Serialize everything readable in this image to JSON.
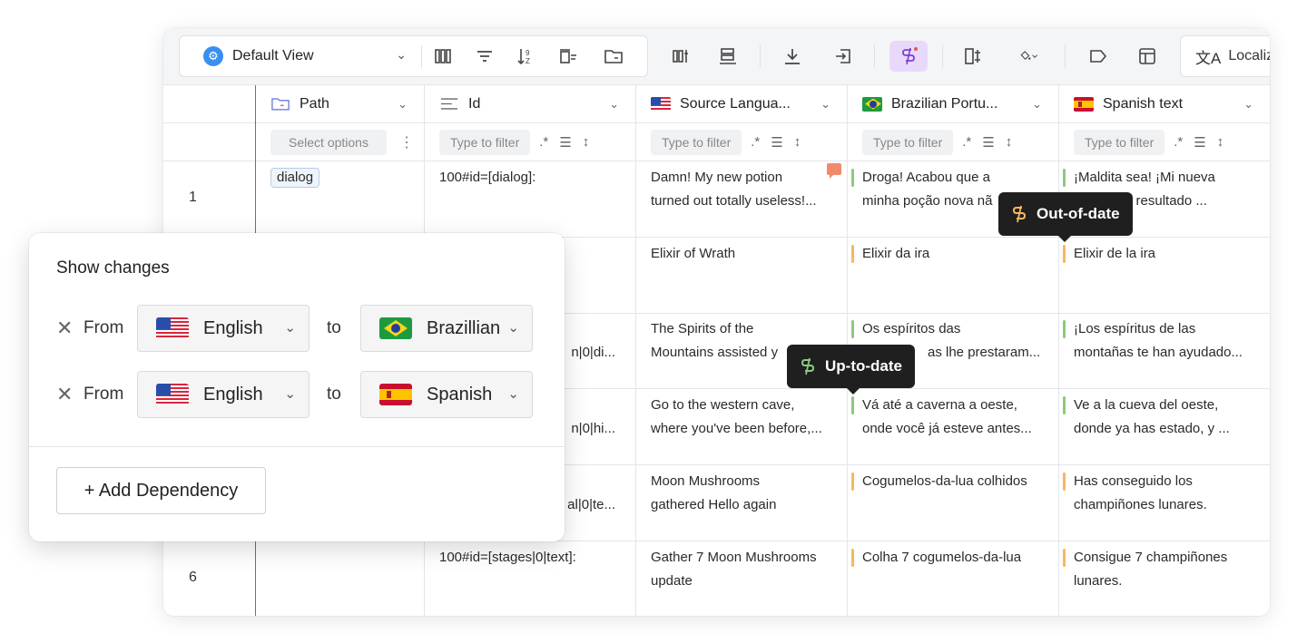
{
  "toolbar": {
    "view_label": "Default View",
    "localize_label": "Localiz"
  },
  "columns": [
    {
      "label": "Path",
      "icon": "folder-icon",
      "filter": "Select options"
    },
    {
      "label": "Id",
      "icon": "text-lines-icon",
      "filter": "Type to filter"
    },
    {
      "label": "Source Langua...",
      "icon": "flag-us",
      "filter": "Type to filter"
    },
    {
      "label": "Brazilian Portu...",
      "icon": "flag-br",
      "filter": "Type to filter"
    },
    {
      "label": "Spanish text",
      "icon": "flag-es",
      "filter": "Type to filter"
    }
  ],
  "rows": [
    {
      "num": "1",
      "path": "dialog",
      "id": "100#id=[dialog]:",
      "source": [
        "Damn! My new potion",
        "turned out totally useless!..."
      ],
      "br": [
        "Droga! Acabou que a",
        "minha poção nova nã"
      ],
      "es": [
        "¡Maldita sea! ¡Mi nueva",
        "a resultado ..."
      ]
    },
    {
      "num": "",
      "path": "",
      "id": "",
      "source": [
        "Elixir of Wrath"
      ],
      "br": [
        "Elixir da ira"
      ],
      "es": [
        "Elixir de la ira"
      ]
    },
    {
      "num": "",
      "path": "",
      "id": "n|0|di...",
      "source": [
        "The Spirits of the",
        "Mountains assisted y"
      ],
      "br": [
        "Os espíritos das",
        "as lhe prestaram..."
      ],
      "es": [
        "¡Los espíritus de las",
        "montañas te han ayudado..."
      ]
    },
    {
      "num": "",
      "path": "",
      "id": "n|0|hi...",
      "source": [
        "Go to the western cave,",
        "where you've been before,..."
      ],
      "br": [
        "Vá até a caverna a oeste,",
        "onde você já esteve antes..."
      ],
      "es": [
        "Ve a la cueva del oeste,",
        "donde ya has estado, y ..."
      ]
    },
    {
      "num": "",
      "path": "",
      "id": "al|0|te...",
      "source": [
        "Moon Mushrooms",
        "gathered Hello again"
      ],
      "br": [
        "Cogumelos-da-lua colhidos"
      ],
      "es": [
        "Has conseguido los",
        "champiñones lunares."
      ]
    },
    {
      "num": "6",
      "path": "",
      "id": "100#id=[stages|0|text]:",
      "source": [
        "Gather 7 Moon Mushrooms",
        "update"
      ],
      "br": [
        "Colha 7 cogumelos-da-lua"
      ],
      "es": [
        "Consigue 7 champiñones",
        "lunares."
      ]
    }
  ],
  "tooltips": {
    "out_of_date": "Out-of-date",
    "up_to_date": "Up-to-date"
  },
  "panel": {
    "title": "Show changes",
    "dependencies": [
      {
        "from_label": "From",
        "from_lang": "English",
        "to_label": "to",
        "to_lang": "Brazillian"
      },
      {
        "from_label": "From",
        "from_lang": "English",
        "to_label": "to",
        "to_lang": "Spanish"
      }
    ],
    "add_button": "+ Add Dependency"
  },
  "colors": {
    "accent_purple": "#7a3fd4",
    "up_to_date": "#8cc97e",
    "out_of_date": "#f5b860"
  }
}
